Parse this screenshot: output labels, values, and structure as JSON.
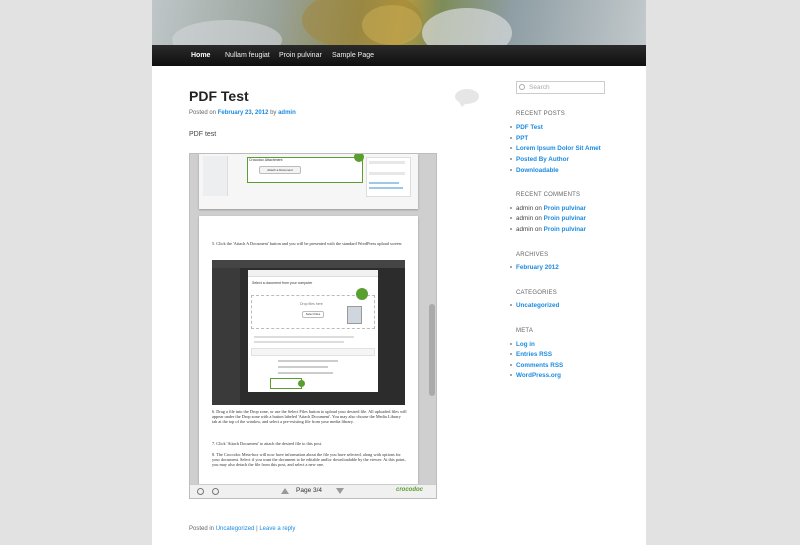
{
  "nav": {
    "items": [
      "Home",
      "Nullam feugiat",
      "Proin pulvinar",
      "Sample Page"
    ]
  },
  "post": {
    "title": "PDF Test",
    "posted_on": "Posted on",
    "date": "February 23, 2012",
    "by": "by",
    "author": "admin",
    "content": "PDF test",
    "footer_posted_in": "Posted in",
    "footer_category": "Uncategorized",
    "footer_sep": "|",
    "footer_reply": "Leave a reply"
  },
  "viewer": {
    "page_label": "Page 3/4",
    "brand": "crocodoc",
    "doc1_panel": "Crocodoc Attachment",
    "doc1_button": "Attach a Document",
    "step5": "5.  Click the 'Attach A Document' button and you will be presented with the standard WordPress upload screen:",
    "upload_title": "Select a document from your computer",
    "drop_text": "Drop files here",
    "select_btn": "Select Files",
    "step6": "6.  Drag a file into the Drop zone, or use the Select Files button to upload your desired file. All uploaded files will appear under the Drop zone with a button labeled 'Attach Document'.  You may also choose the Media Library tab at the top of the window, and select a pre-existing file from your media library.",
    "step7": "7.  Click 'Attach Document' to attach the desired file to this post.",
    "step8": "8.  The Crocodoc Meta-box will now have information about the file you have selected, along with options for your document.  Select if you want the document to be editable and/or downloadable by the viewer.  At this point, you may also detach the file from this post, and select a new one."
  },
  "sidebar": {
    "search_placeholder": "Search",
    "recent_posts_title": "RECENT POSTS",
    "recent_posts": [
      "PDF Test",
      "PPT",
      "Lorem Ipsum Dolor Sit Amet",
      "Posted By Author",
      "Downloadable"
    ],
    "recent_comments_title": "RECENT COMMENTS",
    "recent_comments": [
      {
        "author": "admin",
        "on": "on",
        "post": "Proin pulvinar"
      },
      {
        "author": "admin",
        "on": "on",
        "post": "Proin pulvinar"
      },
      {
        "author": "admin",
        "on": "on",
        "post": "Proin pulvinar"
      }
    ],
    "archives_title": "ARCHIVES",
    "archives": [
      "February 2012"
    ],
    "categories_title": "CATEGORIES",
    "categories": [
      "Uncategorized"
    ],
    "meta_title": "META",
    "meta_links": [
      "Log in",
      "Entries RSS",
      "Comments RSS",
      "WordPress.org"
    ]
  },
  "colors": {
    "link": "#1b8be0",
    "nav_bg": "#1c1c1c",
    "page_bg": "#e2e2e2",
    "brand_green": "#5a9e2f"
  }
}
